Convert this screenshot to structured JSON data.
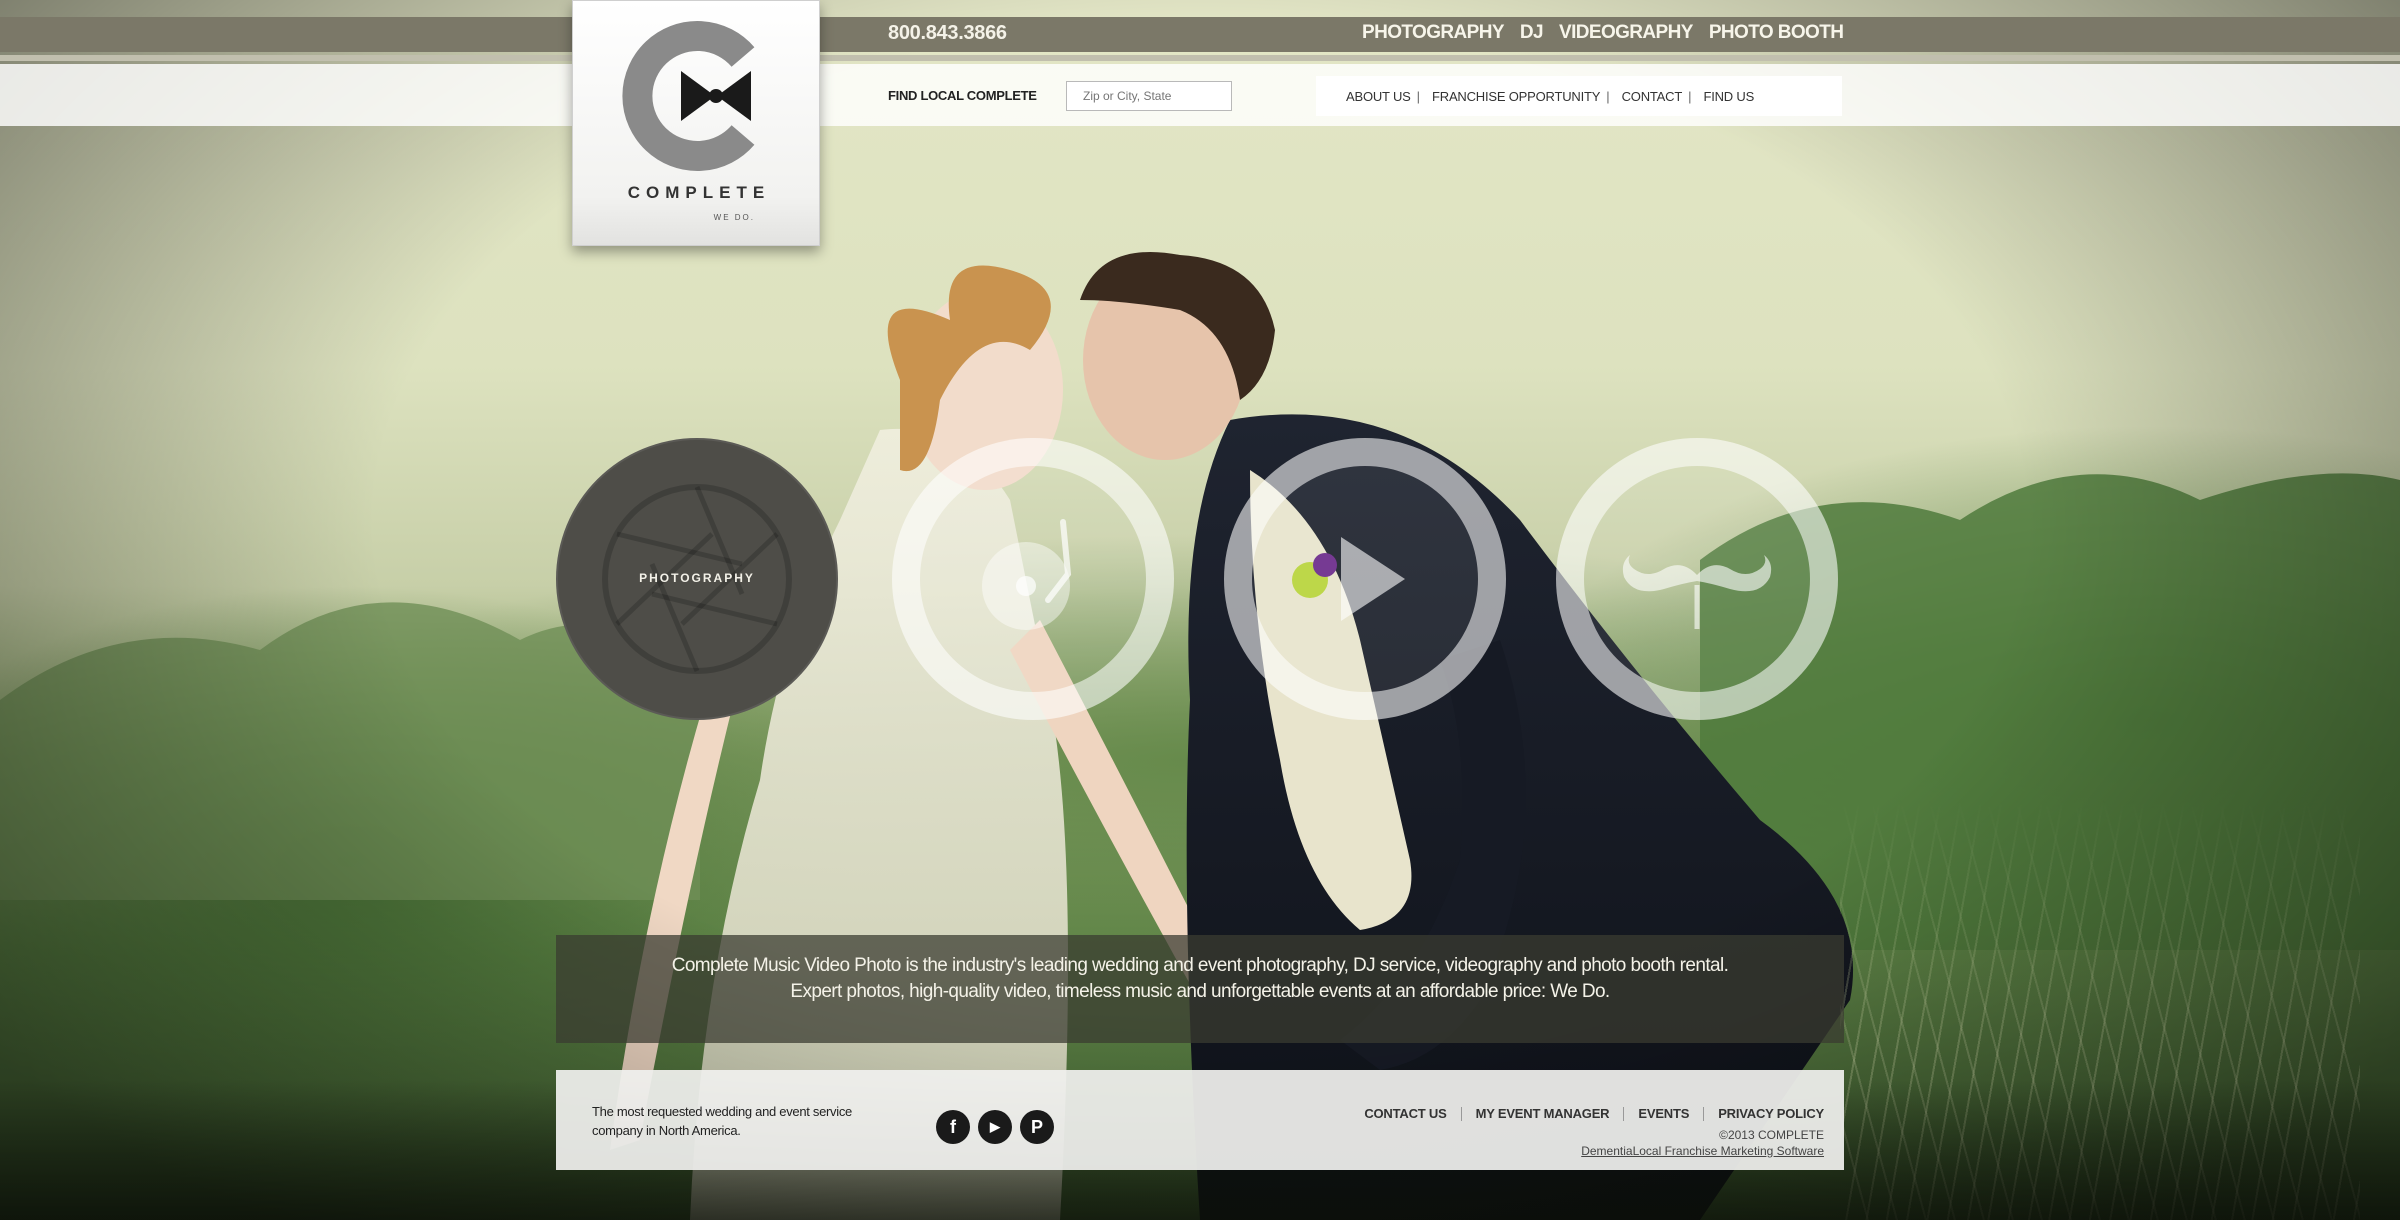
{
  "header": {
    "phone": "800.843.3866",
    "main_nav": [
      "PHOTOGRAPHY",
      "DJ",
      "VIDEOGRAPHY",
      "PHOTO BOOTH"
    ],
    "find_local_label": "FIND LOCAL COMPLETE",
    "zip_placeholder": "Zip or City, State",
    "sub_nav": [
      "ABOUT US",
      "FRANCHISE OPPORTUNITY",
      "CONTACT",
      "FIND US"
    ]
  },
  "logo": {
    "brand": "COMPLETE",
    "tagline": "WE DO."
  },
  "services": [
    {
      "label": "PHOTOGRAPHY",
      "icon": "aperture-icon",
      "active": true
    },
    {
      "label": "DJ",
      "icon": "turntable-icon",
      "active": false
    },
    {
      "label": "VIDEOGRAPHY",
      "icon": "play-icon",
      "active": false
    },
    {
      "label": "PHOTO BOOTH",
      "icon": "mustache-icon",
      "active": false
    }
  ],
  "intro": {
    "line1": "Complete Music Video Photo is the industry's leading wedding and event photography, DJ service, videography and photo booth rental.",
    "line2": "Expert photos, high-quality video, timeless music and unforgettable events at an affordable price: We Do."
  },
  "footer": {
    "tagline": "The most requested wedding and event service company in North America.",
    "social": [
      {
        "name": "facebook-icon",
        "glyph": "f"
      },
      {
        "name": "youtube-icon",
        "glyph": "▶"
      },
      {
        "name": "pinterest-icon",
        "glyph": "P"
      }
    ],
    "links": [
      "CONTACT US",
      "MY EVENT MANAGER",
      "EVENTS",
      "PRIVACY POLICY"
    ],
    "copyright": "©2013 COMPLETE",
    "credit": "DementiaLocal Franchise Marketing Software"
  },
  "colors": {
    "header_bar": "#7b7868",
    "active_circle": "#4e4d48",
    "text_light": "#f4f2e8"
  }
}
